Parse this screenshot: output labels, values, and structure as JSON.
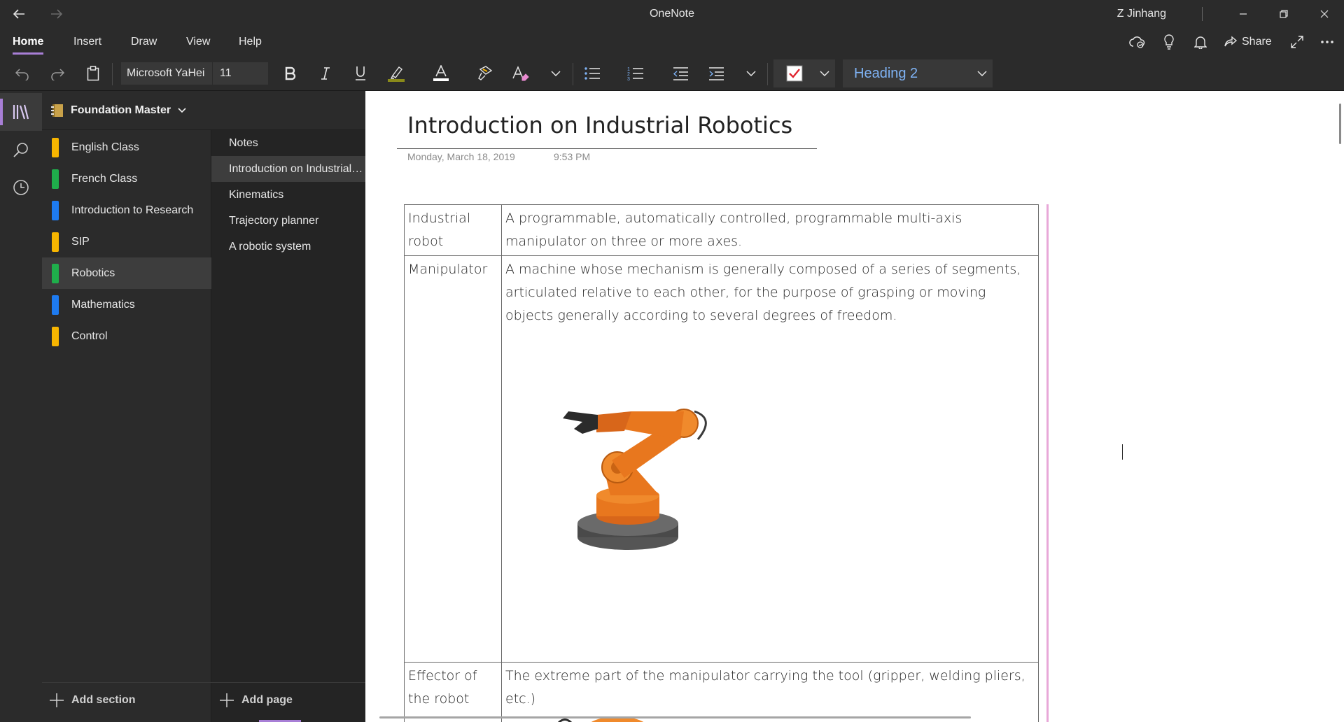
{
  "app": {
    "title": "OneNote",
    "user": "Z Jinhang"
  },
  "menu": {
    "tabs": [
      "Home",
      "Insert",
      "Draw",
      "View",
      "Help"
    ],
    "active_tab": "Home",
    "share_label": "Share"
  },
  "ribbon": {
    "font_name": "Microsoft YaHei",
    "font_size": "11",
    "style": "Heading 2"
  },
  "notebook": {
    "name": "Foundation Master",
    "sections": [
      {
        "label": "English Class",
        "color": "#f7b500"
      },
      {
        "label": "French Class",
        "color": "#1fae4b"
      },
      {
        "label": "Introduction to Research",
        "color": "#1e7bf0"
      },
      {
        "label": "SIP",
        "color": "#f7b500"
      },
      {
        "label": "Robotics",
        "color": "#1fae4b"
      },
      {
        "label": "Mathematics",
        "color": "#1e7bf0"
      },
      {
        "label": "Control",
        "color": "#f7b500"
      }
    ],
    "active_section": "Robotics",
    "pages": [
      "Notes",
      "Introduction on Industrial Robotics",
      "Kinematics",
      "Trajectory planner",
      "A robotic system"
    ],
    "active_page": "Introduction on Industrial Robotics",
    "add_section_label": "Add section",
    "add_page_label": "Add page"
  },
  "page": {
    "title": "Introduction on Industrial Robotics",
    "date": "Monday, March 18, 2019",
    "time": "9:53 PM",
    "table": [
      {
        "term": "Industrial robot",
        "definition": "A programmable, automatically controlled, programmable multi-axis manipulator on three or more axes."
      },
      {
        "term": "Manipulator",
        "definition": "A machine whose mechanism is generally composed of a series of segments, articulated relative to each other, for the purpose of grasping or moving objects generally according to several degrees of freedom."
      },
      {
        "term": "Effector of the robot",
        "definition": "The extreme part of the manipulator carrying the tool (gripper, welding pliers, etc.)"
      }
    ]
  },
  "colors": {
    "accent": "#a87fd6",
    "robot_orange": "#e8771e",
    "style_text": "#7fb3f5"
  },
  "icons": [
    "back-arrow-icon",
    "forward-arrow-icon",
    "minimize-icon",
    "restore-icon",
    "close-icon",
    "sync-icon",
    "lightbulb-icon",
    "bell-icon",
    "share-icon",
    "fullscreen-icon",
    "more-icon",
    "undo-icon",
    "redo-icon",
    "clipboard-icon",
    "bold-icon",
    "italic-icon",
    "underline-icon",
    "highlighter-icon",
    "font-color-icon",
    "format-painter-icon",
    "clear-format-icon",
    "bullets-icon",
    "numbering-icon",
    "outdent-icon",
    "indent-icon",
    "todo-checkbox-icon",
    "notebooks-icon",
    "search-icon",
    "recent-icon",
    "notebook-icon",
    "plus-icon"
  ]
}
